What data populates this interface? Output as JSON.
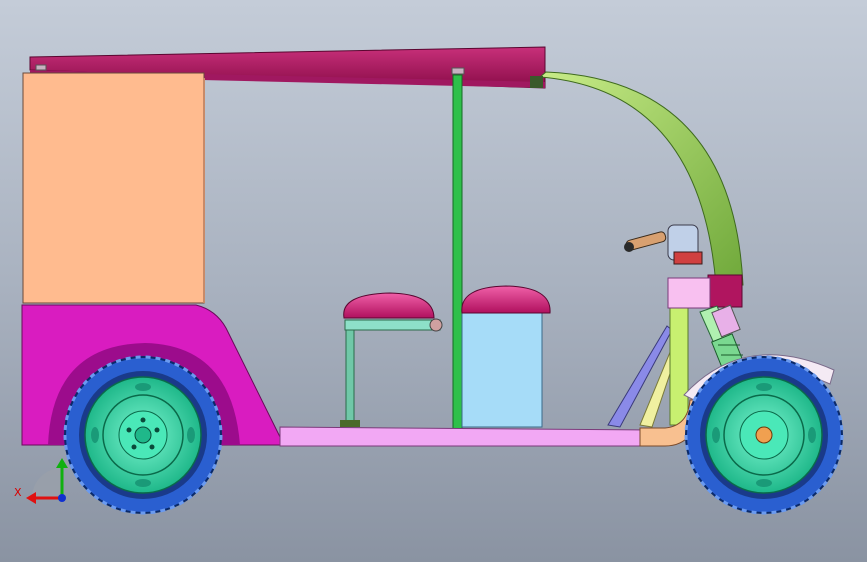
{
  "viewport": {
    "background_top": "#c4ccd8",
    "background_bottom": "#8a93a2"
  },
  "model": {
    "roof_color": "#b0155f",
    "rear_panel_color": "#ffbb8f",
    "body_color": "#d91cc0",
    "seat_cushion_color": "#d81a80",
    "seat_base_color": "#a6dcf8",
    "floor_color": "#f2a8f4",
    "pillar_color": "#2fc04a",
    "canopy_arm_color": "#9ad05c",
    "tyre_color": "#2a5fd0",
    "rim_color": "#35dfa8",
    "fork_color": "#b0f0b0",
    "mudguard_color": "#f4eaf4"
  },
  "triad": {
    "x_label": "X",
    "x_color": "#e01010",
    "y_color": "#10b010",
    "z_color": "#1030d0"
  }
}
